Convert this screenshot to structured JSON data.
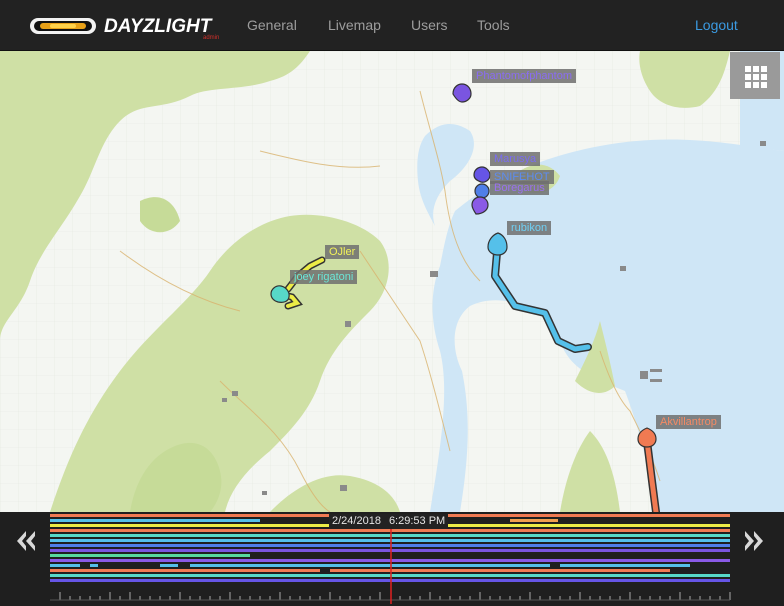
{
  "navbar": {
    "brand": {
      "name": "DAYZLIGHT",
      "sub": "admin"
    },
    "items": [
      {
        "label": "General"
      },
      {
        "label": "Livemap"
      },
      {
        "label": "Users"
      },
      {
        "label": "Tools"
      }
    ],
    "logout_label": "Logout"
  },
  "players": [
    {
      "name": "Phantomofphantom",
      "color": "#7a55e0"
    },
    {
      "name": "Marusya",
      "color": "#6655e6"
    },
    {
      "name": "SNIFEHOT",
      "color": "#4f7fe8"
    },
    {
      "name": "Boregarus",
      "color": "#8a5ae6"
    },
    {
      "name": "rubikon",
      "color": "#55c0ea"
    },
    {
      "name": "OJler",
      "color": "#ecec46"
    },
    {
      "name": "joey rigatoni",
      "color": "#57d8c8"
    },
    {
      "name": "Akvillantrop",
      "color": "#f07a52"
    }
  ],
  "timeline": {
    "date": "2/24/2018",
    "time": "6:29:53 PM",
    "prev_icon": "double-chevron-left-icon",
    "next_icon": "double-chevron-right-icon"
  },
  "colors": {
    "navbar_bg": "#222222",
    "nav_text": "#9d9d9d",
    "logout": "#3b9ae1",
    "land": "#f4f6f2",
    "water": "#cfe6f6",
    "forest": "#cfe0a5",
    "cursor": "#e02020"
  }
}
